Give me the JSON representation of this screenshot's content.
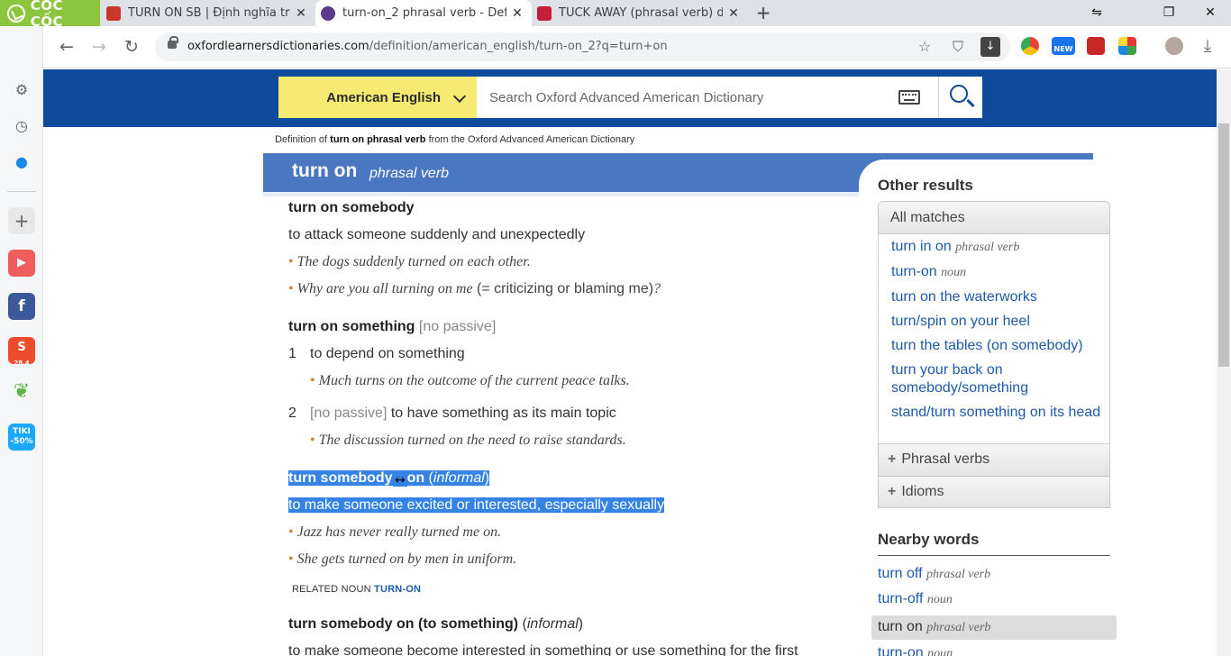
{
  "browser": {
    "brand": "CỐC CỐC",
    "tabs": [
      {
        "title": "TURN ON SB | Định nghĩa tro",
        "favicon_color": "#c8392b"
      },
      {
        "title": "turn-on_2 phrasal verb - Defi",
        "favicon_color": "#5b3b8c"
      },
      {
        "title": "TUCK AWAY (phrasal verb) de",
        "favicon_color": "#c41e3a"
      }
    ],
    "window_controls": {
      "minimize": "⇋",
      "restore": "❐",
      "close": "✕"
    },
    "url_domain": "oxfordlearnersdictionaries.com",
    "url_path": "/definition/american_english/turn-on_2?q=turn+on"
  },
  "sidebar_apps": [
    {
      "icon": "youtube-icon",
      "color": "#f05d5d"
    },
    {
      "icon": "facebook-icon",
      "color": "#3b5998"
    },
    {
      "icon": "shopee-icon",
      "color": "#ee4d2d",
      "badge": "28.4"
    },
    {
      "icon": "leaf-icon",
      "color": "#5bb548"
    },
    {
      "icon": "tiki-icon",
      "color": "#1ba8ff",
      "label": "TIKI -50%"
    }
  ],
  "search": {
    "dictionary": "American English",
    "placeholder": "Search Oxford Advanced American Dictionary"
  },
  "definition_source": {
    "prefix": "Definition of",
    "term": "turn on phrasal verb",
    "suffix": "from the Oxford Advanced American Dictionary"
  },
  "headword": {
    "word": "turn on",
    "pos": "phrasal verb"
  },
  "senses": {
    "s1": {
      "phrase": "turn on somebody",
      "definition": "to attack someone suddenly and unexpectedly",
      "examples": [
        "The dogs suddenly turned on each other."
      ],
      "ex2_main": "Why are you all turning on me",
      "ex2_gloss": " (= criticizing or blaming me)",
      "ex2_end": "?"
    },
    "s2": {
      "phrase": "turn on something",
      "grammar": "[no passive]",
      "sub1": {
        "num": "1",
        "definition": "to depend on something",
        "example": "Much turns on the outcome of the current peace talks."
      },
      "sub2": {
        "num": "2",
        "grammar": "[no passive]",
        "definition": "to have something as its main topic",
        "example": "The discussion turned on the need to raise standards."
      }
    },
    "s3": {
      "phrase_a": "turn somebody",
      "phrase_b": "on",
      "label": "informal",
      "definition": "to make someone excited or interested, especially sexually",
      "examples": [
        "Jazz has never really turned me on.",
        "She gets turned on by men in uniform."
      ],
      "related_label": "RELATED NOUN",
      "related_link": "TURN-ON"
    },
    "s4": {
      "phrase": "turn somebody on (to something)",
      "label": "informal",
      "definition": "to make someone become interested in something or use something for the first"
    }
  },
  "other_results": {
    "title": "Other results",
    "all_matches": "All matches",
    "matches": [
      {
        "text": "turn in on",
        "pos": "phrasal verb"
      },
      {
        "text": "turn-on",
        "pos": "noun"
      },
      {
        "text": "turn on the waterworks",
        "pos": ""
      },
      {
        "text": "turn/spin on your heel",
        "pos": ""
      },
      {
        "text": "turn the tables (on somebody)",
        "pos": ""
      },
      {
        "text": "turn your back on somebody/something",
        "pos": ""
      },
      {
        "text": "stand/turn something on its head",
        "pos": ""
      }
    ],
    "phrasal_verbs": "Phrasal verbs",
    "idioms": "Idioms"
  },
  "nearby_words": {
    "title": "Nearby words",
    "items": [
      {
        "text": "turn off",
        "pos": "phrasal verb"
      },
      {
        "text": "turn-off",
        "pos": "noun"
      },
      {
        "text": "turn on",
        "pos": "phrasal verb"
      },
      {
        "text": "turn-on",
        "pos": "noun"
      }
    ]
  },
  "colors": {
    "oxford_blue": "#0f4a9b",
    "headword_band": "#4a77c1",
    "highlight": "#3583e5",
    "selector_yellow": "#f7ea73",
    "brand_green": "#8cc63f"
  }
}
